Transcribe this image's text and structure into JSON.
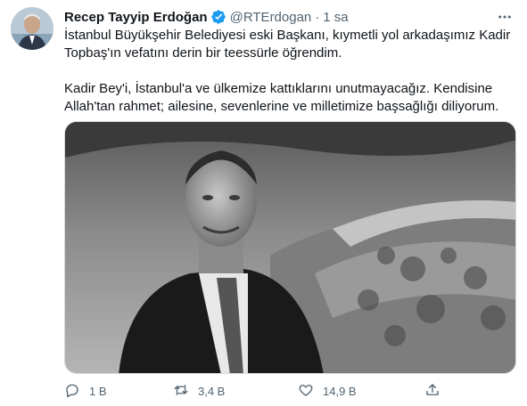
{
  "tweet": {
    "display_name": "Recep Tayyip Erdoğan",
    "handle": "@RTErdogan",
    "separator": "·",
    "time": "1 sa",
    "paragraphs": [
      "İstanbul Büyükşehir Belediyesi eski Başkanı, kıymetli yol arkadaşımız Kadir Topbaş'ın vefatını derin bir teessürle öğrendim.",
      "Kadir Bey'i, İstanbul'a ve ülkemize kattıklarını unutmayacağız. Kendisine Allah'tan rahmet; ailesine, sevenlerine ve milletimize başsağlığı diliyorum."
    ],
    "actions": {
      "replies": "1 B",
      "retweets": "3,4 B",
      "likes": "14,9 B"
    }
  },
  "colors": {
    "verified_badge": "#1d9bf0",
    "secondary_text": "#536471",
    "primary_text": "#0f1419"
  },
  "icons": {
    "verified": "verified-badge-icon",
    "more": "more-dots-icon",
    "reply": "reply-icon",
    "retweet": "retweet-icon",
    "like": "heart-icon",
    "share": "share-icon"
  }
}
